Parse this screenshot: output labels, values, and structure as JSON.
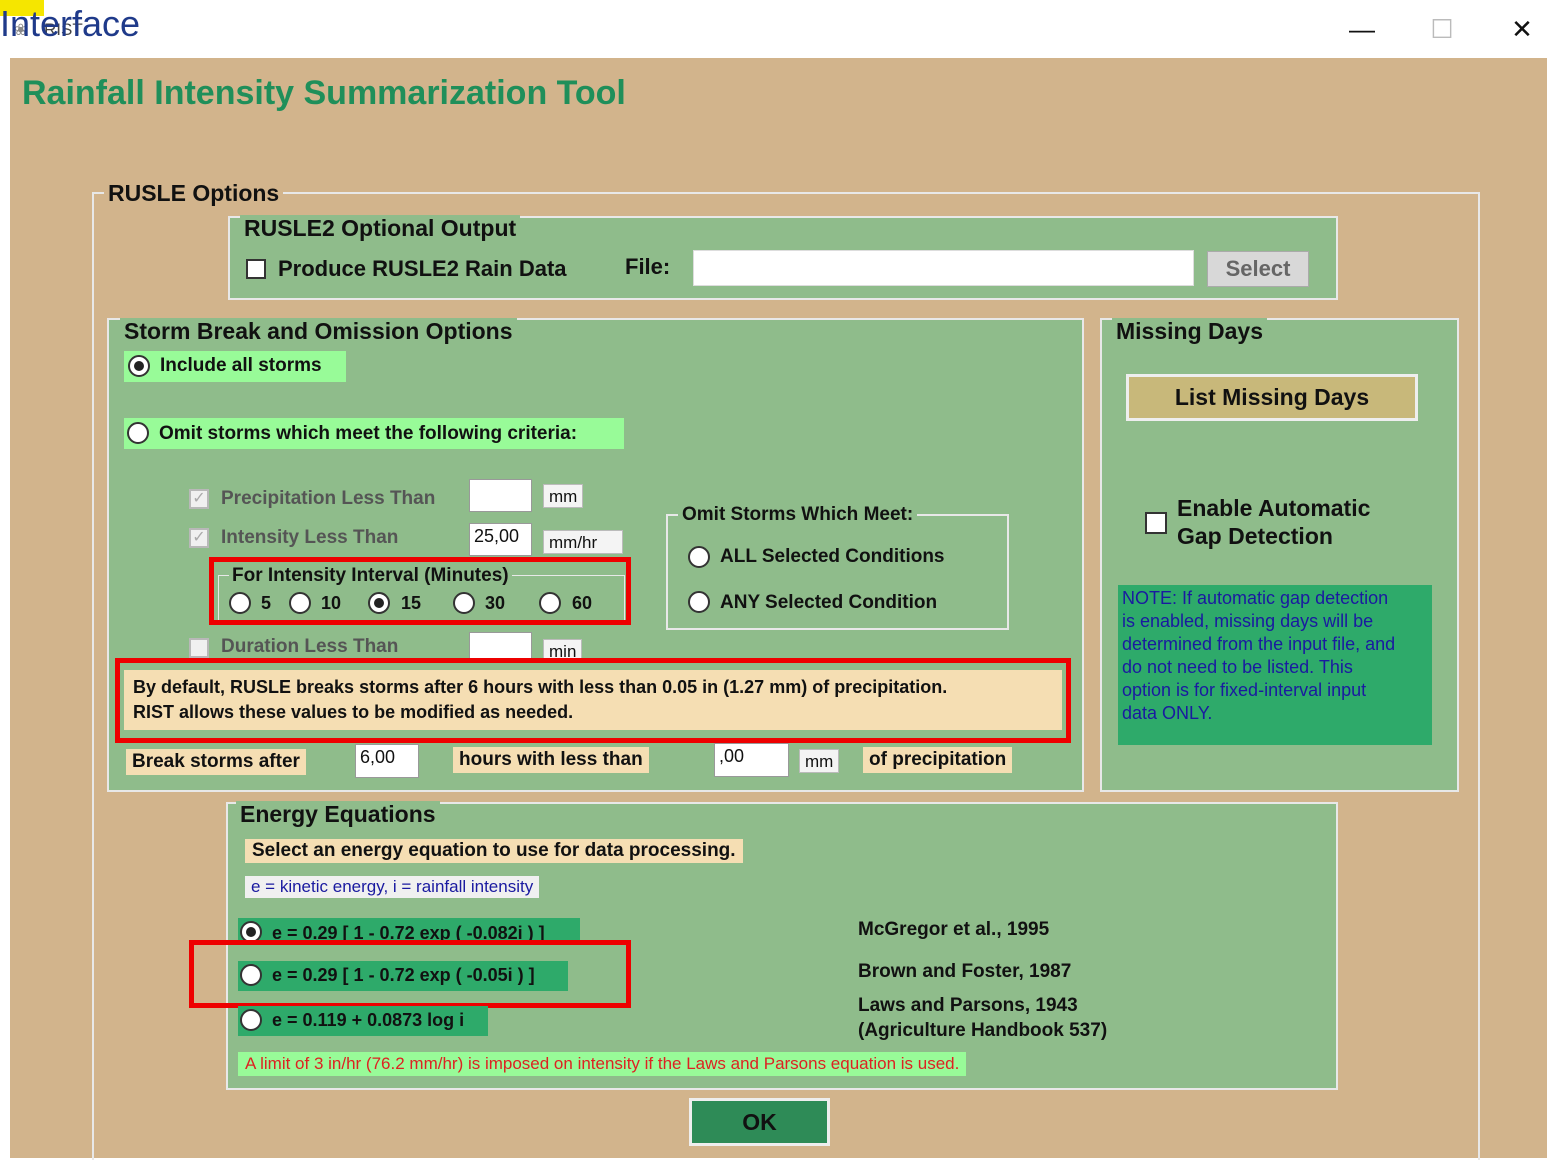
{
  "overlay_label": "Interface",
  "window": {
    "small_title": "RIST",
    "minimize": "—",
    "maximize": "☐",
    "close": "✕"
  },
  "app_title": "Rainfall Intensity Summarization Tool",
  "rusle_options": {
    "legend": "RUSLE Options",
    "rusle2_output": {
      "legend": "RUSLE2 Optional Output",
      "checkbox_label": "Produce RUSLE2 Rain Data",
      "file_label": "File:",
      "file_value": "",
      "select_button": "Select"
    },
    "storm_break": {
      "legend": "Storm Break and Omission Options",
      "include_all": "Include all storms",
      "omit_storms": "Omit storms which meet the following criteria:",
      "precip_label": "Precipitation Less Than",
      "precip_value": "",
      "precip_unit": "mm",
      "intensity_label": "Intensity Less Than",
      "intensity_value": "25,00",
      "intensity_unit": "mm/hr",
      "interval_legend": "For Intensity Interval (Minutes)",
      "intervals": [
        "5",
        "10",
        "15",
        "30",
        "60"
      ],
      "interval_selected": "15",
      "duration_label": "Duration Less Than",
      "duration_value": "",
      "duration_unit": "min",
      "omit_meet_legend": "Omit Storms Which Meet:",
      "all_conditions": "ALL Selected Conditions",
      "any_condition": "ANY Selected Condition",
      "note_line1": "By default, RUSLE breaks storms after 6 hours with less than 0.05 in (1.27 mm) of precipitation.",
      "note_line2": "RIST allows these values to be modified as needed.",
      "break_after": "Break storms after",
      "break_hours_value": "6,00",
      "hours_with": "hours with less than",
      "less_than_value": ",00",
      "less_than_unit": "mm",
      "of_precip": "of precipitation"
    },
    "missing_days": {
      "legend": "Missing Days",
      "list_button": "List Missing Days",
      "gap_line1": "Enable Automatic",
      "gap_line2": "Gap Detection",
      "note_lines": [
        "NOTE:  If automatic gap detection",
        "is enabled, missing days will be",
        "determined from the input file, and",
        "do not need to be listed.  This",
        "option is for fixed-interval input",
        "data ONLY."
      ]
    },
    "energy": {
      "legend": "Energy Equations",
      "instruction": "Select an energy equation to use for data processing.",
      "definition": "e = kinetic energy, i = rainfall intensity",
      "equations": [
        {
          "formula": "e = 0.29 [ 1 - 0.72 exp ( -0.082i ) ]",
          "reference": "McGregor et al., 1995"
        },
        {
          "formula": "e = 0.29 [ 1 - 0.72 exp ( -0.05i ) ]",
          "reference": "Brown and Foster, 1987"
        },
        {
          "formula": "e = 0.119 + 0.0873 log i",
          "reference": "Laws and Parsons, 1943",
          "reference2": "(Agriculture Handbook 537)"
        }
      ],
      "selected_index": 0,
      "limit_note": "A limit of 3 in/hr (76.2 mm/hr) is imposed on intensity if the Laws and Parsons equation is used."
    },
    "ok_button": "OK"
  },
  "colors": {
    "window_bg": "#d2b48c",
    "panel_green": "#8fbc8b",
    "title_green": "#1f8f5a",
    "highlight_red": "#ee0000",
    "note_green": "#2eaa6a",
    "light_green_label": "#98fb98"
  }
}
